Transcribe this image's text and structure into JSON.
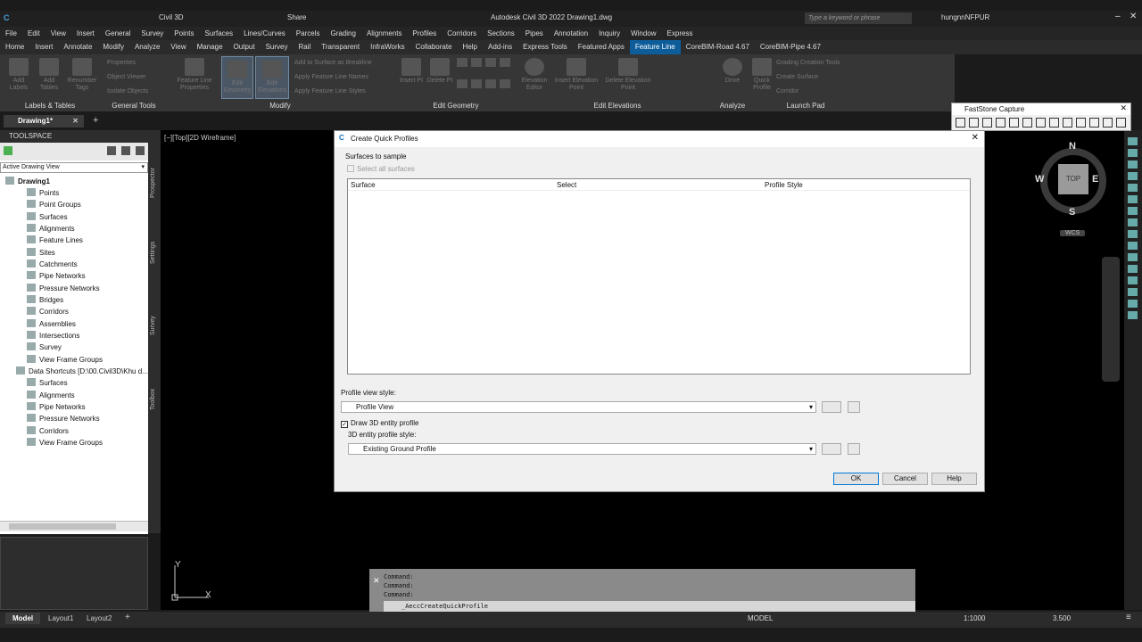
{
  "app": {
    "title": "Autodesk Civil 3D 2022   Drawing1.dwg",
    "workspace": "Civil 3D",
    "share": "Share",
    "search_placeholder": "Type a keyword or phrase",
    "user": "hungnnNFPUR"
  },
  "menu": [
    "File",
    "Edit",
    "View",
    "Insert",
    "General",
    "Survey",
    "Points",
    "Surfaces",
    "Lines/Curves",
    "Parcels",
    "Grading",
    "Alignments",
    "Profiles",
    "Corridors",
    "Sections",
    "Pipes",
    "Annotation",
    "Inquiry",
    "Window",
    "Express"
  ],
  "ribbon_tabs": [
    "Home",
    "Insert",
    "Annotate",
    "Modify",
    "Analyze",
    "View",
    "Manage",
    "Output",
    "Survey",
    "Rail",
    "Transparent",
    "InfraWorks",
    "Collaborate",
    "Help",
    "Add-ins",
    "Express Tools",
    "Featured Apps",
    "Feature Line",
    "CoreBIM-Road 4.67",
    "CoreBIM-Pipe 4.67"
  ],
  "ribbon": {
    "panels": [
      "Labels & Tables",
      "General Tools",
      "Modify",
      "Edit Geometry",
      "Edit Elevations",
      "Analyze",
      "Launch Pad"
    ],
    "buttons": {
      "add_labels": "Add Labels",
      "add_tables": "Add Tables",
      "renumber_tags": "Renumber Tags",
      "properties": "Properties",
      "object_viewer": "Object Viewer",
      "isolate_objects": "Isolate Objects",
      "fl_props": "Feature Line Properties",
      "edit_geometry": "Edit Geometry",
      "edit_elevations": "Edit Elevations",
      "add_to_surface": "Add to Surface as Breakline",
      "apply_names": "Apply Feature Line Names",
      "apply_styles": "Apply Feature Line Styles",
      "insert_pi": "Insert PI",
      "delete_pi": "Delete PI",
      "elev_editor": "Elevation Editor",
      "insert_elev_pt": "Insert Elevation Point",
      "delete_elev_pt": "Delete Elevation Point",
      "drive": "Drive",
      "quick_profile": "Quick Profile",
      "grading_tools": "Grading Creation Tools",
      "create_surface": "Create Surface",
      "corridor": "Corridor"
    }
  },
  "doc_tab": "Drawing1*",
  "toolspace": {
    "header": "TOOLSPACE",
    "view": "Active Drawing View",
    "items": [
      "Drawing1",
      "Points",
      "Point Groups",
      "Surfaces",
      "Alignments",
      "Feature Lines",
      "Sites",
      "Catchments",
      "Pipe Networks",
      "Pressure Networks",
      "Bridges",
      "Corridors",
      "Assemblies",
      "Intersections",
      "Survey",
      "View Frame Groups",
      "Data Shortcuts [D:\\00.Civil3D\\Khu d...",
      "Surfaces",
      "Alignments",
      "Pipe Networks",
      "Pressure Networks",
      "Corridors",
      "View Frame Groups"
    ],
    "side_tabs": [
      "Prospector",
      "Settings",
      "Survey",
      "Toolbox"
    ]
  },
  "viewport_label": "[−][Top][2D Wireframe]",
  "viewcube": {
    "n": "N",
    "s": "S",
    "e": "E",
    "w": "W",
    "top": "TOP",
    "wcs": "WCS"
  },
  "dialog": {
    "title": "Create Quick Profiles",
    "surfaces_to_sample": "Surfaces to sample",
    "select_all": "Select all surfaces",
    "col_surface": "Surface",
    "col_select": "Select",
    "col_profile_style": "Profile Style",
    "pv_style_label": "Profile view style:",
    "pv_style_value": "Profile View",
    "draw3d": "Draw 3D entity profile",
    "entity_style_label": "3D entity profile style:",
    "entity_style_value": "Existing Ground Profile",
    "ok": "OK",
    "cancel": "Cancel",
    "help": "Help"
  },
  "faststone": {
    "title": "FastStone Capture"
  },
  "command": {
    "lines": [
      "Command:",
      "Command:",
      "Command:"
    ],
    "input": "_AeccCreateQuickProfile"
  },
  "layout_tabs": [
    "Model",
    "Layout1",
    "Layout2"
  ],
  "status": {
    "model": "MODEL",
    "scale": "1:1000",
    "lineweight": "3.500"
  },
  "axis": {
    "x": "X",
    "y": "Y"
  }
}
